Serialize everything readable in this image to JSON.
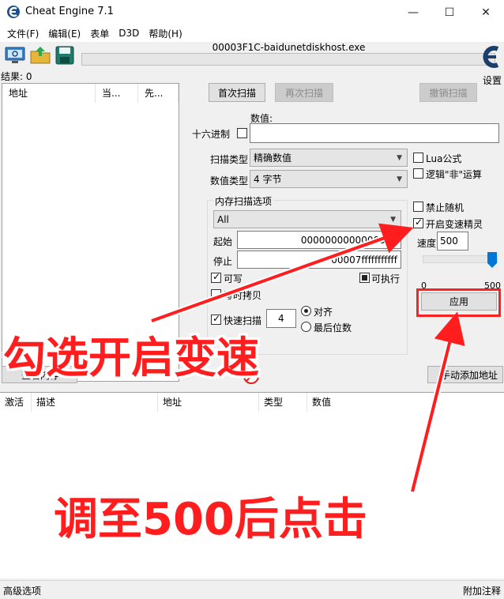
{
  "window": {
    "title": "Cheat Engine 7.1",
    "minimize": "—",
    "maximize": "☐",
    "close": "✕"
  },
  "menu": [
    "文件(F)",
    "编辑(E)",
    "表单",
    "D3D",
    "帮助(H)"
  ],
  "toolbar": {
    "process_name": "00003F1C-baidunetdiskhost.exe",
    "settings_label": "设置"
  },
  "results_label": "结果: 0",
  "address_list": {
    "columns": [
      "地址",
      "当...",
      "先..."
    ]
  },
  "scan": {
    "first_scan": "首次扫描",
    "next_scan": "再次扫描",
    "undo_scan": "撤销扫描",
    "value_label": "数值:",
    "hex_label": "十六进制",
    "value": "",
    "scan_type_label": "扫描类型",
    "scan_type": "精确数值",
    "value_type_label": "数值类型",
    "value_type": "4 字节",
    "lua_formula": "Lua公式",
    "logic_not": "逻辑\"非\"运算"
  },
  "memory_options": {
    "title": "内存扫描选项",
    "region": "All",
    "start_label": "起始",
    "start_value": "0000000000000000",
    "stop_label": "停止",
    "stop_value": "00007fffffffffff",
    "writable": "可写",
    "executable": "可执行",
    "copy_on_write": "写时拷贝",
    "fast_scan": "快速扫描",
    "fast_scan_value": "4",
    "align": "对齐",
    "last_digits": "最后位数"
  },
  "speedhack": {
    "disable_random": "禁止随机",
    "enable_speedhack": "开启变速精灵",
    "speed_label": "速度",
    "speed_value": "500",
    "slider_min": "0",
    "slider_max": "500",
    "slider_fraction": 1.0,
    "apply": "应用"
  },
  "buttons": {
    "memory_view": "查看内存",
    "add_address": "手动添加地址"
  },
  "table": {
    "columns": [
      "激活",
      "描述",
      "地址",
      "类型",
      "数值"
    ]
  },
  "status": {
    "left": "高级选项",
    "right": "附加注释"
  },
  "annotations": {
    "tick_speedhack": "勾选开启变速",
    "set_500_click": "调至500后点击"
  },
  "colors": {
    "annotation": "#ff1d1d",
    "slider_accent": "#0078d7"
  }
}
